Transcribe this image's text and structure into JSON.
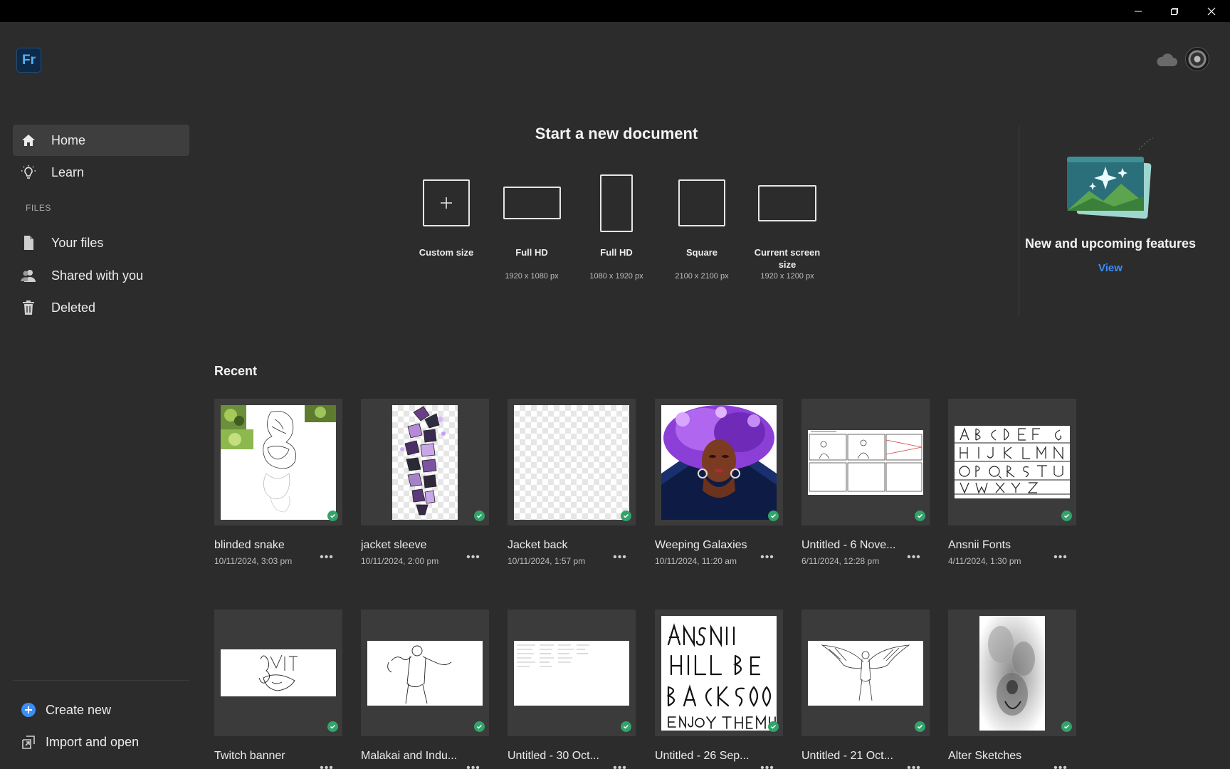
{
  "app": {
    "logo_text": "Fr",
    "window_controls": [
      "minimize-icon",
      "restore-icon",
      "close-icon"
    ]
  },
  "header": {
    "cloud_icon": "cloud-icon",
    "avatar": "avatar"
  },
  "sidebar": {
    "items": [
      {
        "label": "Home",
        "icon": "home-icon"
      },
      {
        "label": "Learn",
        "icon": "lightbulb-icon"
      }
    ],
    "files_section": "FILES",
    "file_items": [
      {
        "label": "Your files",
        "icon": "file-icon"
      },
      {
        "label": "Shared with you",
        "icon": "users-icon"
      },
      {
        "label": "Deleted",
        "icon": "trash-icon"
      }
    ],
    "bottom_items": [
      {
        "label": "Create new",
        "icon": "plus-circle-icon"
      },
      {
        "label": "Import and open",
        "icon": "import-icon"
      }
    ]
  },
  "new_document": {
    "title": "Start a new document",
    "presets": [
      {
        "name": "Custom size",
        "size": ""
      },
      {
        "name": "Full HD",
        "size": "1920 x 1080 px"
      },
      {
        "name": "Full HD",
        "size": "1080 x 1920 px"
      },
      {
        "name": "Square",
        "size": "2100 x 2100 px"
      },
      {
        "name": "Current screen size",
        "size": "1920 x 1200 px"
      }
    ]
  },
  "features": {
    "title": "New and upcoming features",
    "link": "View"
  },
  "recent": {
    "title": "Recent",
    "files": [
      {
        "title": "blinded snake",
        "date": "10/11/2024, 3:03 pm"
      },
      {
        "title": "jacket sleeve",
        "date": "10/11/2024, 2:00 pm"
      },
      {
        "title": "Jacket back",
        "date": "10/11/2024, 1:57 pm"
      },
      {
        "title": "Weeping Galaxies",
        "date": "10/11/2024, 11:20 am"
      },
      {
        "title": "Untitled - 6 Nove...",
        "date": "6/11/2024, 12:28 pm"
      },
      {
        "title": "Ansnii Fonts",
        "date": "4/11/2024, 1:30 pm"
      },
      {
        "title": "Twitch banner",
        "date": ""
      },
      {
        "title": "Malakai and Indu...",
        "date": ""
      },
      {
        "title": "Untitled - 30 Oct...",
        "date": ""
      },
      {
        "title": "Untitled - 26 Sep...",
        "date": ""
      },
      {
        "title": "Untitled - 21 Oct...",
        "date": ""
      },
      {
        "title": "Alter Sketches",
        "date": ""
      }
    ],
    "more_label": "•••"
  },
  "colors": {
    "accent": "#3d8df5",
    "sync_green": "#33a36b",
    "background": "#2c2c2c"
  }
}
